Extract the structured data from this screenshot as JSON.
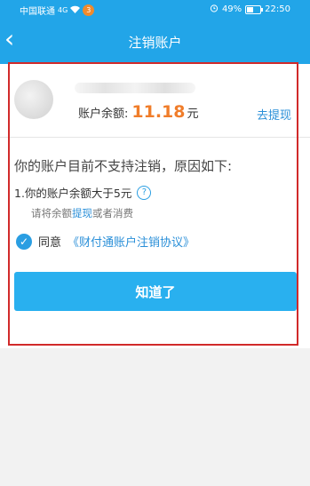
{
  "status_bar": {
    "carrier": "中国联通",
    "signal": "4G",
    "notification_badge": "3",
    "battery": "49%",
    "time": "22:50"
  },
  "nav": {
    "back_icon": "‹",
    "title": "注销账户"
  },
  "account": {
    "balance_label": "账户余额:",
    "balance_value": "11.18",
    "balance_unit": "元",
    "withdraw_link": "去提现"
  },
  "reasons": {
    "title": "你的账户目前不支持注销，原因如下:",
    "items": [
      {
        "text": "1.你的账户余额大于5元",
        "hint_prefix": "请将余额",
        "hint_link": "提现",
        "hint_suffix": "或者消费"
      }
    ]
  },
  "agreement": {
    "label": "同意",
    "link": "《财付通账户注销协议》"
  },
  "confirm_button": "知道了",
  "colors": {
    "primary": "#22a5e8",
    "button": "#29b0ef",
    "amount": "#f07d2a",
    "link": "#2a8fd8",
    "highlight": "#d12a2a"
  }
}
